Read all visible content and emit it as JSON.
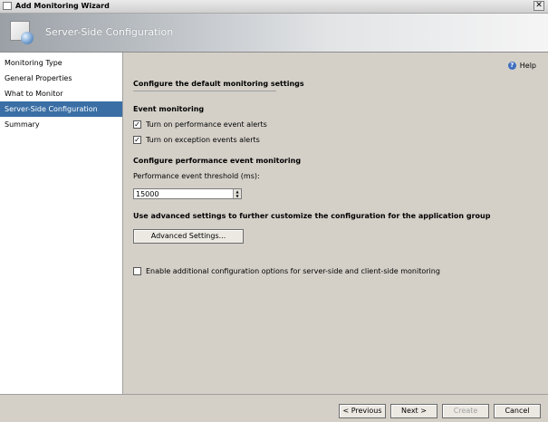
{
  "window": {
    "title": "Add Monitoring Wizard",
    "close_glyph": "✕"
  },
  "banner": {
    "title": "Server-Side Configuration"
  },
  "nav": {
    "items": [
      {
        "label": "Monitoring Type"
      },
      {
        "label": "General Properties"
      },
      {
        "label": "What to Monitor"
      },
      {
        "label": "Server-Side Configuration",
        "selected": true
      },
      {
        "label": "Summary"
      }
    ]
  },
  "content": {
    "help_label": "Help",
    "heading": "Configure the default monitoring settings",
    "event_monitoring": {
      "title": "Event monitoring",
      "perf_alerts_label": "Turn on performance event alerts",
      "perf_alerts_checked": true,
      "exception_alerts_label": "Turn on exception events alerts",
      "exception_alerts_checked": true
    },
    "perf_monitoring": {
      "title": "Configure performance event monitoring",
      "threshold_label": "Performance event threshold (ms):",
      "threshold_value": "15000"
    },
    "advanced": {
      "title": "Use advanced settings to further customize the configuration for the application group",
      "button_label": "Advanced Settings..."
    },
    "additional_options": {
      "label": "Enable additional configuration options for server-side and client-side monitoring",
      "checked": false
    }
  },
  "footer": {
    "previous_label": "< Previous",
    "next_label": "Next >",
    "create_label": "Create",
    "cancel_label": "Cancel"
  },
  "colors": {
    "selection": "#3a6ea5",
    "dialog_bg": "#d4d0c8"
  }
}
